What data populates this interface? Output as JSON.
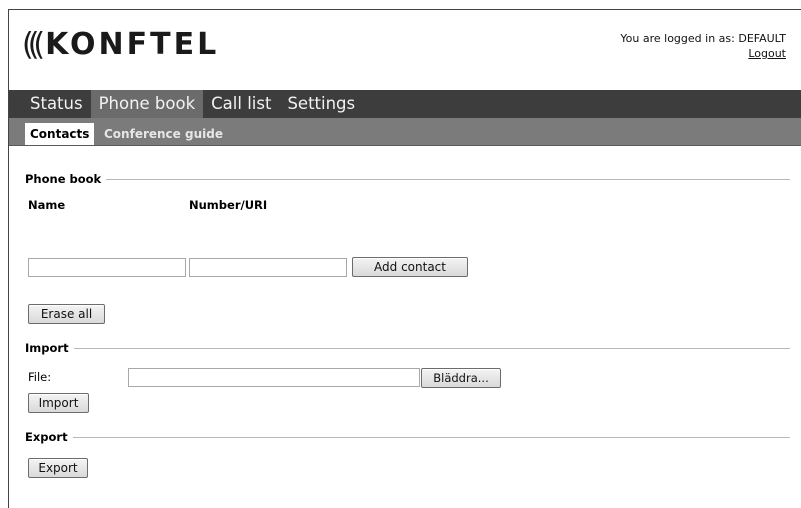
{
  "header": {
    "logo_waves": "(((",
    "logo_text": "KONFTEL",
    "login_text": "You are logged in as: DEFAULT",
    "logout_label": "Logout"
  },
  "main_nav": {
    "tabs": [
      "Status",
      "Phone book",
      "Call list",
      "Settings"
    ],
    "active": "Phone book"
  },
  "sub_nav": {
    "tabs": [
      "Contacts",
      "Conference guide"
    ],
    "active": "Contacts"
  },
  "phonebook": {
    "legend": "Phone book",
    "col_name": "Name",
    "col_number": "Number/URI",
    "name_value": "",
    "number_value": "",
    "add_label": "Add contact",
    "erase_label": "Erase all"
  },
  "import_section": {
    "legend": "Import",
    "file_label": "File:",
    "file_value": "",
    "browse_label": "Bläddra...",
    "import_label": "Import"
  },
  "export_section": {
    "legend": "Export",
    "export_label": "Export"
  }
}
